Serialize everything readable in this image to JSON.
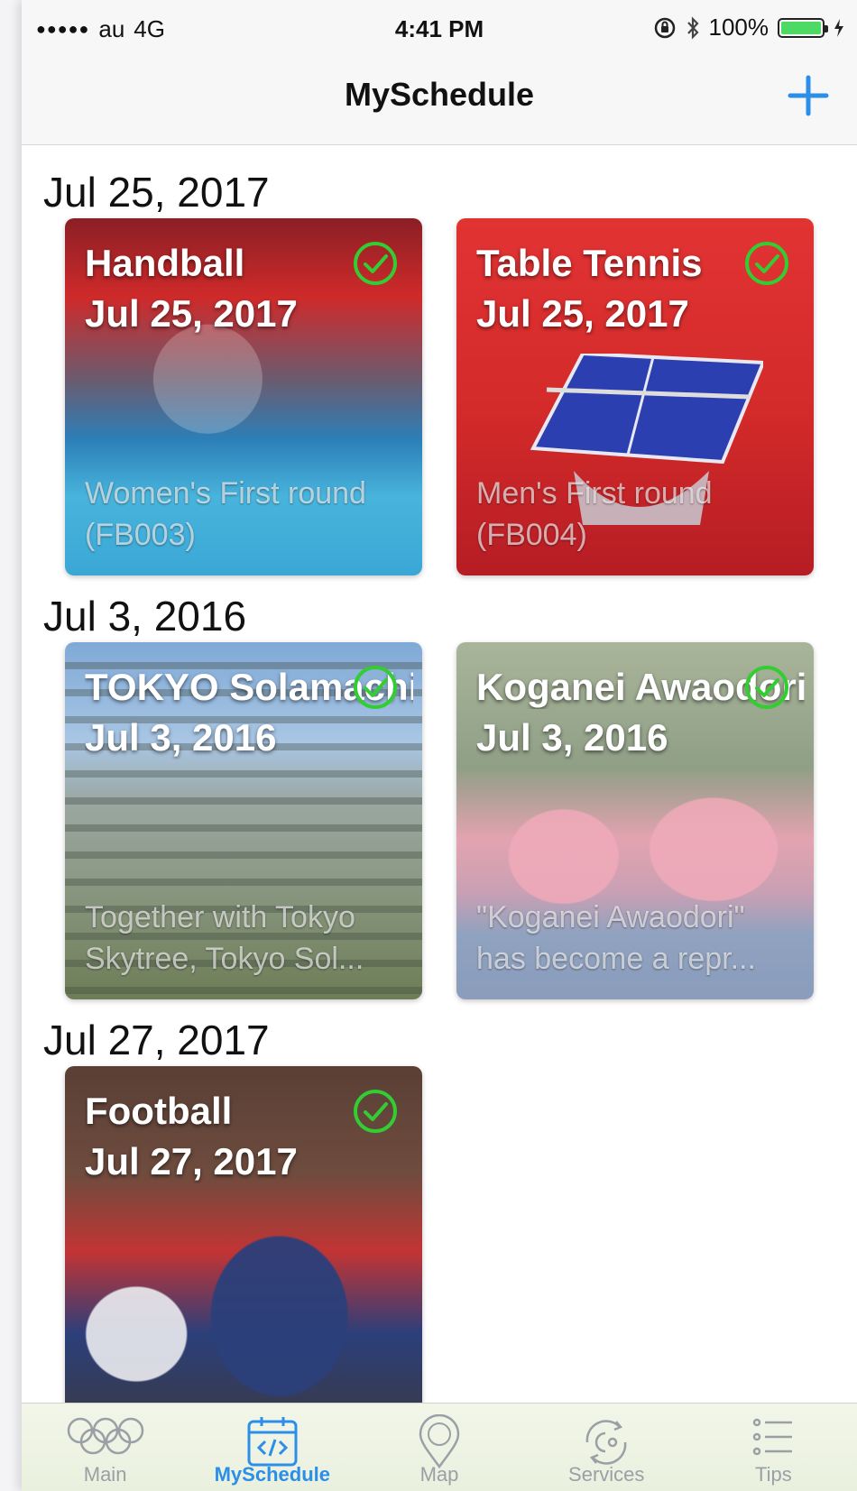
{
  "status_bar": {
    "signal": "●●●●●",
    "carrier": "au",
    "network": "4G",
    "time": "4:41 PM",
    "battery": "100%",
    "battery_level": 1.0
  },
  "nav": {
    "title": "MySchedule",
    "add_icon": "plus-icon"
  },
  "sections": [
    {
      "date": "Jul 25, 2017",
      "cards": [
        {
          "title": "Handball",
          "date": "Jul 25, 2017",
          "desc": "Women's First round (FB003)",
          "checked": true,
          "colors": [
            "#cf2a2a",
            "#2c7fb8",
            "#48b4dc"
          ]
        },
        {
          "title": "Table Tennis",
          "date": "Jul 25, 2017",
          "desc": "Men's First round (FB004)",
          "checked": true,
          "colors": [
            "#e23333",
            "#d32a2a",
            "#b51d24"
          ]
        }
      ]
    },
    {
      "date": "Jul 3, 2016",
      "cards": [
        {
          "title": "TOKYO Solamachi",
          "date": "Jul 3, 2016",
          "desc": "Together with Tokyo Skytree, Tokyo Sol...",
          "checked": true,
          "colors": [
            "#7fa9d6",
            "#9aa7a1",
            "#6d7d56"
          ]
        },
        {
          "title": "Koganei Awaodori",
          "date": "Jul 3, 2016",
          "desc": "\"Koganei Awaodori\" has become a repr...",
          "checked": true,
          "colors": [
            "#a9b59a",
            "#e3a3b0",
            "#8fa2bf"
          ]
        }
      ]
    },
    {
      "date": "Jul 27, 2017",
      "cards": [
        {
          "title": "Football",
          "date": "Jul 27, 2017",
          "desc": "",
          "checked": true,
          "colors": [
            "#5a3f35",
            "#c23434",
            "#2b3f7a"
          ]
        }
      ]
    }
  ],
  "tabs": [
    {
      "label": "Main",
      "icon": "olympic-rings-icon",
      "active": false
    },
    {
      "label": "MySchedule",
      "icon": "calendar-code-icon",
      "active": true
    },
    {
      "label": "Map",
      "icon": "map-pin-icon",
      "active": false
    },
    {
      "label": "Services",
      "icon": "services-icon",
      "active": false
    },
    {
      "label": "Tips",
      "icon": "list-icon",
      "active": false
    }
  ],
  "colors": {
    "accent": "#2b8fe8",
    "check": "#33cc33",
    "battery_fill": "#4cd964"
  }
}
